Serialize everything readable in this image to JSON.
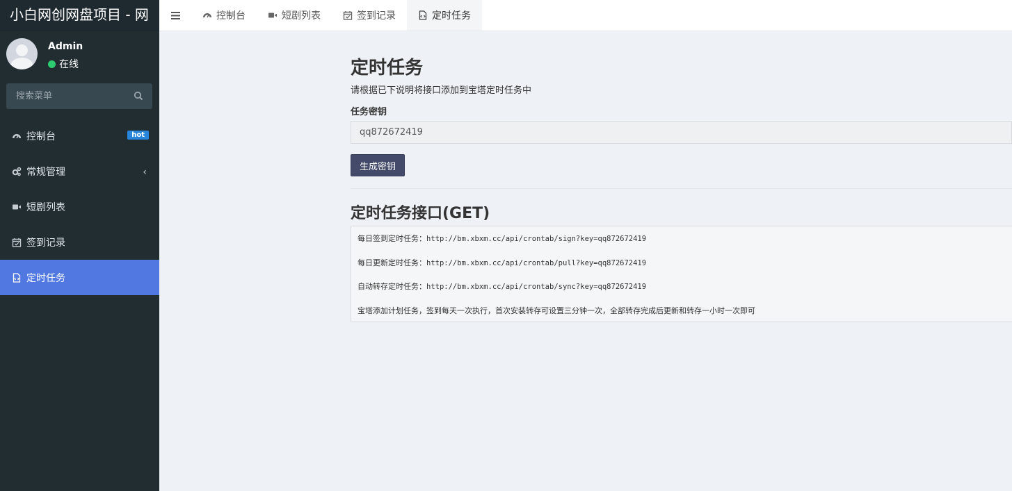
{
  "brand": {
    "title": "小白网创网盘项目 - 网"
  },
  "user": {
    "name": "Admin",
    "status": "在线"
  },
  "search": {
    "placeholder": "搜索菜单"
  },
  "sidebar": {
    "items": [
      {
        "label": "控制台",
        "icon": "dashboard-icon",
        "badge": "hot"
      },
      {
        "label": "常规管理",
        "icon": "cogs-icon"
      },
      {
        "label": "短剧列表",
        "icon": "video-icon"
      },
      {
        "label": "签到记录",
        "icon": "calendar-check-icon"
      },
      {
        "label": "定时任务",
        "icon": "file-code-icon",
        "active": true
      }
    ]
  },
  "tabs": [
    {
      "label": "控制台",
      "icon": "dashboard-icon"
    },
    {
      "label": "短剧列表",
      "icon": "video-icon"
    },
    {
      "label": "签到记录",
      "icon": "calendar-check-icon"
    },
    {
      "label": "定时任务",
      "icon": "file-code-icon",
      "active": true
    }
  ],
  "main": {
    "title": "定时任务",
    "description": "请根据已下说明将接口添加到宝塔定时任务中",
    "key_label": "任务密钥",
    "key_value": "qq872672419",
    "generate_button": "生成密钥",
    "api_title": "定时任务接口(GET)",
    "api_lines": [
      {
        "label": "每日签到定时任务：",
        "url": "http://bm.xbxm.cc/api/crontab/sign?key=qq872672419"
      },
      {
        "label": "每日更新定时任务：",
        "url": "http://bm.xbxm.cc/api/crontab/pull?key=qq872672419"
      },
      {
        "label": "自动转存定时任务：",
        "url": "http://bm.xbxm.cc/api/crontab/sync?key=qq872672419"
      }
    ],
    "note": "宝塔添加计划任务，签到每天一次执行，首次安装转存可设置三分钟一次，全部转存完成后更新和转存一小时一次即可"
  },
  "colors": {
    "sidebar_bg": "#222d32",
    "active_item": "#5178e1",
    "status_online": "#2ecc71",
    "badge": "#2786db",
    "button": "#434a6a"
  }
}
